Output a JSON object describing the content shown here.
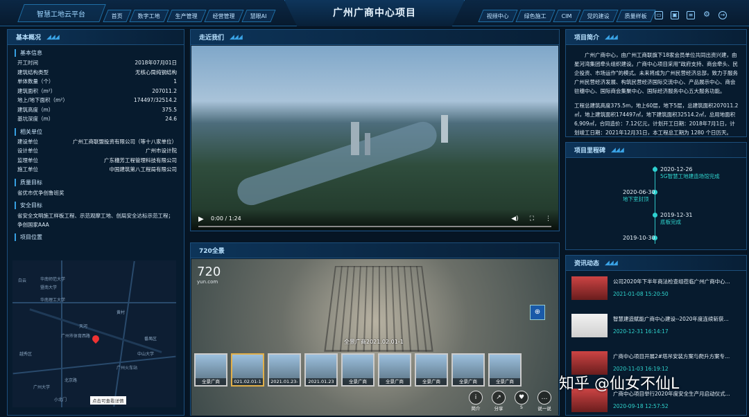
{
  "header": {
    "brand": "智慧工地云平台",
    "title": "广州广商中心项目",
    "nav_left": [
      "首页",
      "数字工地",
      "生产管理",
      "经营管理",
      "慧眼AI"
    ],
    "nav_right": [
      "视频中心",
      "绿色施工",
      "CIM",
      "党的建设",
      "质量样板"
    ],
    "tools": [
      "monitor-icon",
      "screen-icon",
      "document-icon",
      "gear-icon",
      "power-icon"
    ]
  },
  "overview": {
    "title": "基本概况",
    "basic_title": "基本信息",
    "basic": [
      {
        "k": "开工时间",
        "v": "2018年07月01日"
      },
      {
        "k": "建筑结构类型",
        "v": "无核心筒纯钢结构"
      },
      {
        "k": "单体数量（个）",
        "v": "1"
      },
      {
        "k": "建筑面积（m²）",
        "v": "207011.2"
      },
      {
        "k": "地上/地下面积（m²）",
        "v": "174497/32514.2"
      },
      {
        "k": "建筑高度（m）",
        "v": "375.5"
      },
      {
        "k": "基坑深度（m）",
        "v": "24.6"
      }
    ],
    "units_title": "相关单位",
    "units": [
      {
        "k": "建设单位",
        "v": "广州工商联盟投资有限公司（等十八家单位）"
      },
      {
        "k": "设计单位",
        "v": "广州市设计院"
      },
      {
        "k": "监理单位",
        "v": "广东穗芳工程管理科技有限公司"
      },
      {
        "k": "施工单位",
        "v": "中国建筑第八工程局有限公司"
      }
    ],
    "quality_title": "质量目标",
    "quality_text": "省优市优争创鲁班奖",
    "safety_title": "安全目标",
    "safety_text": "省安全文明施工样板工程、示范观摩工地、创局安全达标示范工程；争创国家AAA",
    "location_title": "项目位置",
    "map_labels": [
      "华南师范大学",
      "暨南大学",
      "华南理工大学",
      "黄村",
      "天河",
      "广州市体育西路",
      "番禺区",
      "越秀区",
      "越秀",
      "北京路",
      "广州大学",
      "小北门",
      "广州火车站",
      "中山大学",
      "白云"
    ],
    "map_tip": "点击可查看详情"
  },
  "video": {
    "title": "走近我们",
    "time": "0:00 / 1:24"
  },
  "pano": {
    "title": "720全景",
    "logo": "720",
    "logo_sub": "yun.com",
    "scene_label": "全景广商2021.02.01-1",
    "thumbs": [
      "全景广商",
      "021.02.01-1",
      "2021.01.23-",
      "2021.01.23",
      "全景广商",
      "全景广商",
      "全景广商",
      "全景广商",
      "全景广商"
    ],
    "buttons": [
      {
        "icon": "info-icon",
        "label": "简介"
      },
      {
        "icon": "share-icon",
        "label": "分享"
      },
      {
        "icon": "like-icon",
        "label": "5"
      },
      {
        "icon": "comment-icon",
        "label": "说一说"
      }
    ]
  },
  "intro": {
    "title": "项目简介",
    "para1": "广州广商中心，由广州工商联旗下18家会员单位共同出资兴建，由星河湾集团牵头组织建设。广商中心项目采用\"政府支持、商会牵头、民企投资、市场运作\"的模式。未来将成为广州民营经济总部，致力于服务广州民营经济发展、构筑民营经济国际交流中心、产品展示中心、商会驻穗中心、国际商会集聚中心、国际经济服务中心五大服务功能。",
    "para2": "工程总建筑高度375.5m，地上60层，地下5层，总建筑面积207011.2㎡，地上建筑面积174497㎡，地下建筑面积32514.2㎡，总用地面积6,909㎡，合同造价：7.12亿元，计划开工日期：2018年7月1日，计划竣工日期：2021年12月31日，本工程总工期为 1280 个日历天。"
  },
  "milestones": {
    "title": "项目里程碑",
    "items": [
      {
        "date": "2020-12-26",
        "text": "5G智慧工地建造场馆完成"
      },
      {
        "date": "2020-06-30",
        "text": "地下室封顶"
      },
      {
        "date": "2019-12-31",
        "text": "底板完成"
      },
      {
        "date": "2019-10-30",
        "text": ""
      }
    ]
  },
  "news": {
    "title": "资讯动态",
    "items": [
      {
        "title": "公司2020年下半年商法检查组莅临广州广商中心...",
        "date": "2021-01-08 15:20:50"
      },
      {
        "title": "智慧建造赋能广商中心建设--2020年度连续斩获...",
        "date": "2020-12-31 16:14:17"
      },
      {
        "title": "广商中心项目开展2#塔吊安装方案与爬升方案专...",
        "date": "2020-11-03 16:19:12"
      },
      {
        "title": "广商中心项目举行2020年度安全生产月启动仪式...",
        "date": "2020-09-18 12:57:52"
      }
    ]
  },
  "watermark": "知乎 @仙女不仙L"
}
